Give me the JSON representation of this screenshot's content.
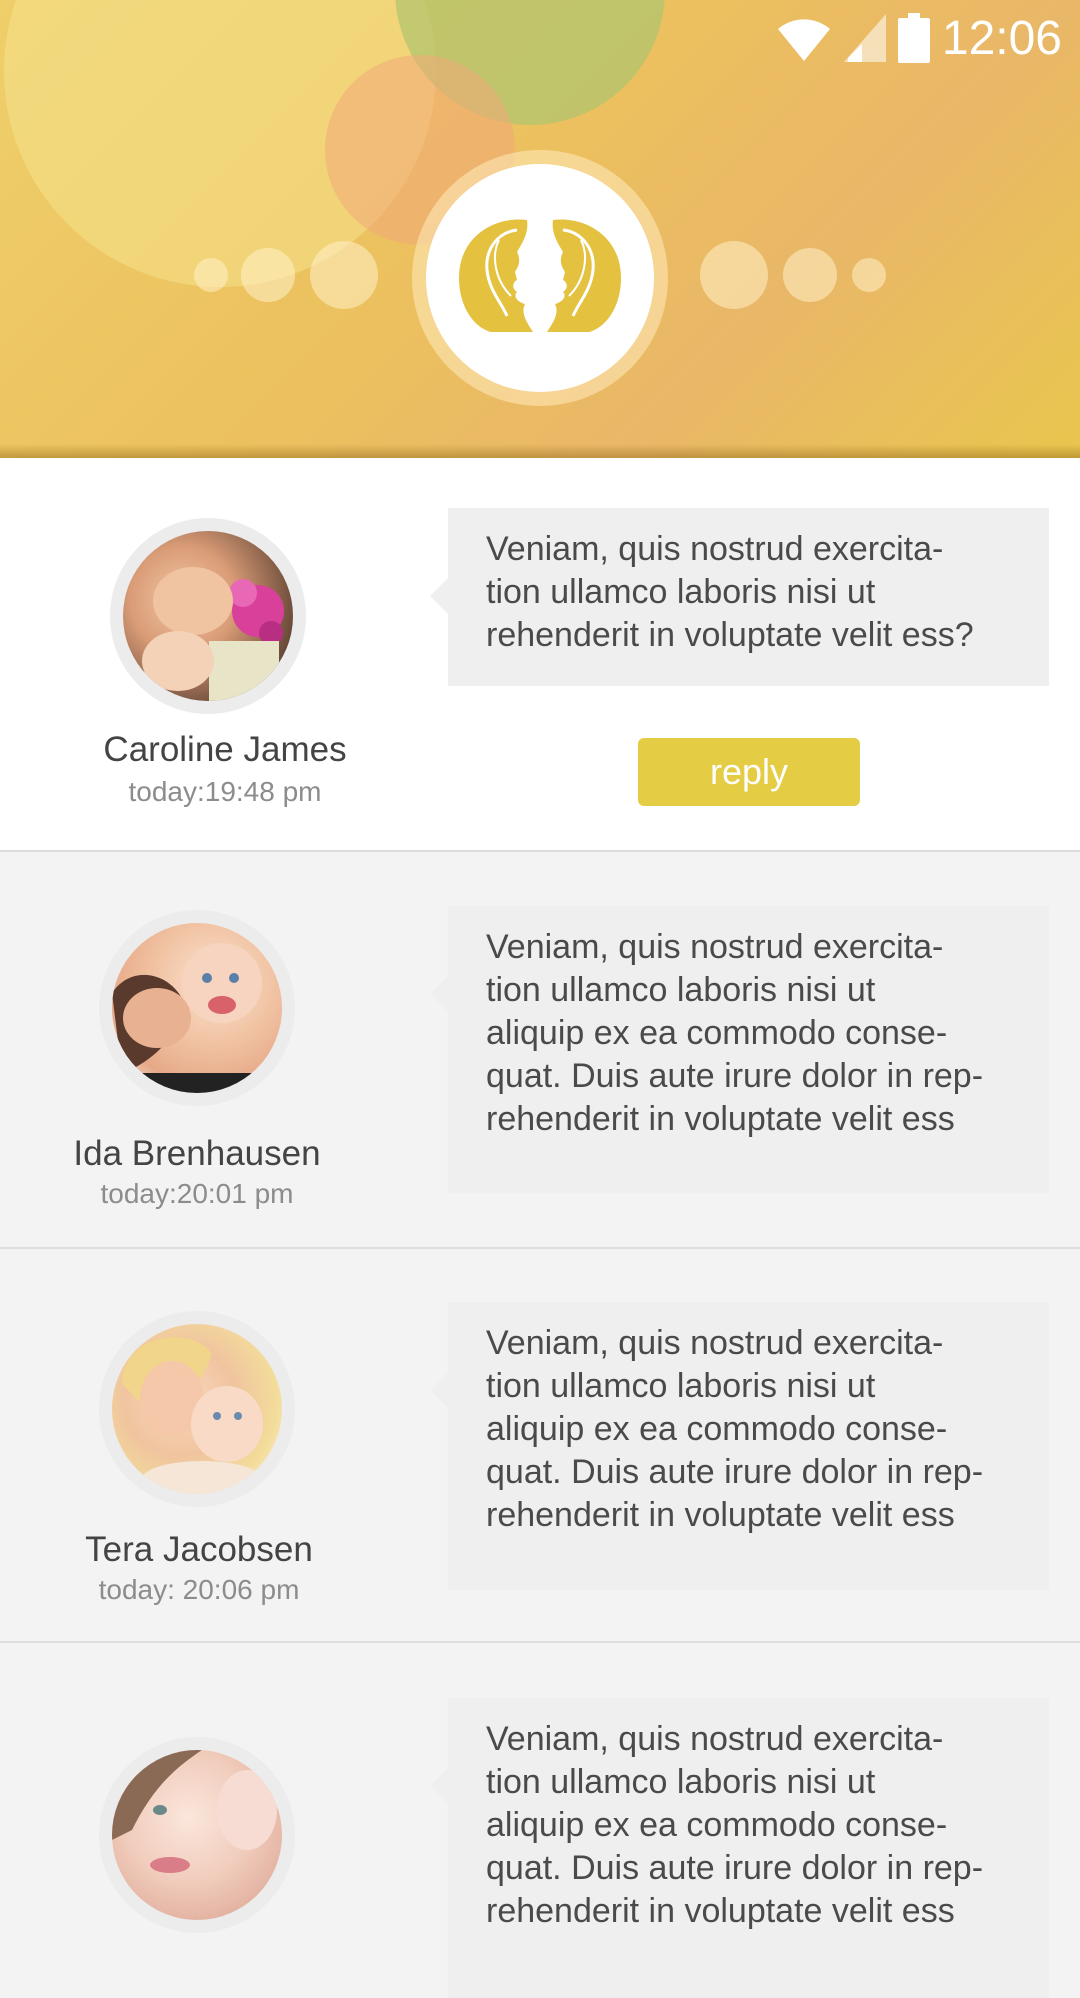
{
  "status_bar": {
    "time": "12:06",
    "icons": [
      "wifi-icon",
      "signal-icon",
      "battery-icon"
    ]
  },
  "header": {
    "emblem": "gemini-zodiac-icon",
    "colors": {
      "primary": "#e9c55a",
      "accent": "#e4cc45"
    }
  },
  "messages": [
    {
      "name": "Caroline James",
      "time": "today:19:48 pm",
      "text": "Veniam, quis nostrud exercita-\ntion ullamco laboris nisi ut\nrehenderit in voluptate velit ess?",
      "reply_label": "reply"
    },
    {
      "name": "Ida Brenhausen",
      "time": "today:20:01 pm",
      "text": "Veniam, quis nostrud exercita-\ntion ullamco laboris nisi ut\naliquip ex ea commodo conse-\nquat. Duis aute irure dolor in rep-\nrehenderit in voluptate velit ess"
    },
    {
      "name": "Tera Jacobsen",
      "time": "today: 20:06 pm",
      "text": "Veniam, quis nostrud exercita-\ntion ullamco laboris nisi ut\naliquip ex ea commodo conse-\nquat. Duis aute irure dolor in rep-\nrehenderit in voluptate velit ess"
    },
    {
      "text": "Veniam, quis nostrud exercita-\ntion ullamco laboris nisi ut\naliquip ex ea commodo conse-\nquat. Duis aute irure dolor in rep-\nrehenderit in voluptate velit ess"
    }
  ]
}
